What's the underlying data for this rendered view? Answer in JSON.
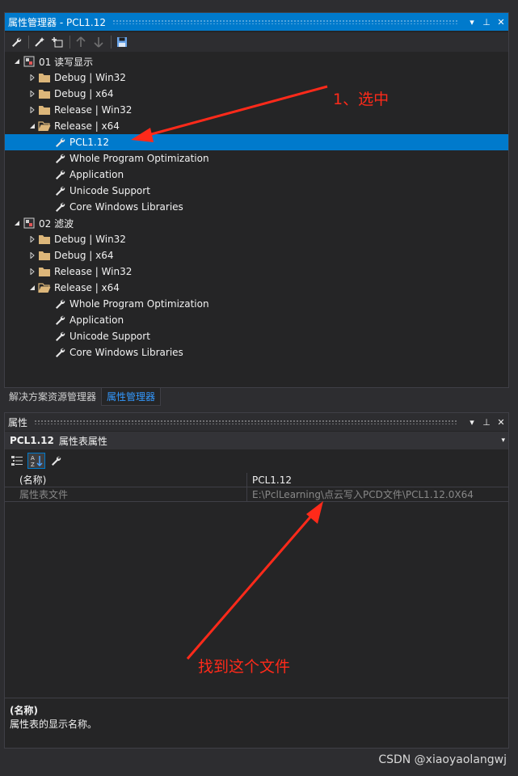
{
  "property_manager": {
    "title": "属性管理器 - PCL1.12",
    "title_controls": [
      "▾",
      "⊥",
      "✕"
    ],
    "toolbar_icons": [
      "wrench-icon",
      "wand-icon",
      "add-property-sheet-icon",
      "up-arrow-icon",
      "down-arrow-icon",
      "save-icon"
    ],
    "tree": [
      {
        "level": 0,
        "expander": "open",
        "icon": "project-icon",
        "label": "01 读写显示"
      },
      {
        "level": 1,
        "expander": "closed",
        "icon": "folder-icon",
        "label": "Debug | Win32"
      },
      {
        "level": 1,
        "expander": "closed",
        "icon": "folder-icon",
        "label": "Debug | x64"
      },
      {
        "level": 1,
        "expander": "closed",
        "icon": "folder-icon",
        "label": "Release | Win32"
      },
      {
        "level": 1,
        "expander": "open",
        "icon": "folder-open-icon",
        "label": "Release | x64"
      },
      {
        "level": 2,
        "expander": "none",
        "icon": "wrench-icon",
        "label": "PCL1.12",
        "selected": true
      },
      {
        "level": 2,
        "expander": "none",
        "icon": "wrench-icon",
        "label": "Whole Program Optimization"
      },
      {
        "level": 2,
        "expander": "none",
        "icon": "wrench-icon",
        "label": "Application"
      },
      {
        "level": 2,
        "expander": "none",
        "icon": "wrench-icon",
        "label": "Unicode Support"
      },
      {
        "level": 2,
        "expander": "none",
        "icon": "wrench-icon",
        "label": "Core Windows Libraries"
      },
      {
        "level": 0,
        "expander": "open",
        "icon": "project-icon",
        "label": "02 滤波"
      },
      {
        "level": 1,
        "expander": "closed",
        "icon": "folder-icon",
        "label": "Debug | Win32"
      },
      {
        "level": 1,
        "expander": "closed",
        "icon": "folder-icon",
        "label": "Debug | x64"
      },
      {
        "level": 1,
        "expander": "closed",
        "icon": "folder-icon",
        "label": "Release | Win32"
      },
      {
        "level": 1,
        "expander": "open",
        "icon": "folder-open-icon",
        "label": "Release | x64"
      },
      {
        "level": 2,
        "expander": "none",
        "icon": "wrench-icon",
        "label": "Whole Program Optimization"
      },
      {
        "level": 2,
        "expander": "none",
        "icon": "wrench-icon",
        "label": "Application"
      },
      {
        "level": 2,
        "expander": "none",
        "icon": "wrench-icon",
        "label": "Unicode Support"
      },
      {
        "level": 2,
        "expander": "none",
        "icon": "wrench-icon",
        "label": "Core Windows Libraries"
      }
    ]
  },
  "tabs": [
    {
      "label": "解决方案资源管理器",
      "active": false
    },
    {
      "label": "属性管理器",
      "active": true
    }
  ],
  "properties_panel": {
    "title": "属性",
    "title_controls": [
      "▾",
      "⊥",
      "✕"
    ],
    "object_name": "PCL1.12",
    "object_type": "属性表属性",
    "toolbar_icons": [
      "categorized-icon",
      "alphabetical-sort-icon",
      "property-pages-icon"
    ],
    "rows": [
      {
        "key": "(名称)",
        "value": "PCL1.12",
        "dim": false
      },
      {
        "key": "属性表文件",
        "value": "E:\\PclLearning\\点云写入PCD文件\\PCL1.12.0X64",
        "dim": true
      }
    ],
    "description_title": "(名称)",
    "description_text": "属性表的显示名称。"
  },
  "annotations": {
    "select_note": "1、选中",
    "file_note": "找到这个文件",
    "color": "#ff2a1a"
  },
  "watermark": "CSDN @xiaoyaolangwj",
  "colors": {
    "accent": "#007acc",
    "panel_bg": "#252526",
    "chrome_bg": "#2d2d30",
    "tab_active_text": "#3399ff"
  }
}
